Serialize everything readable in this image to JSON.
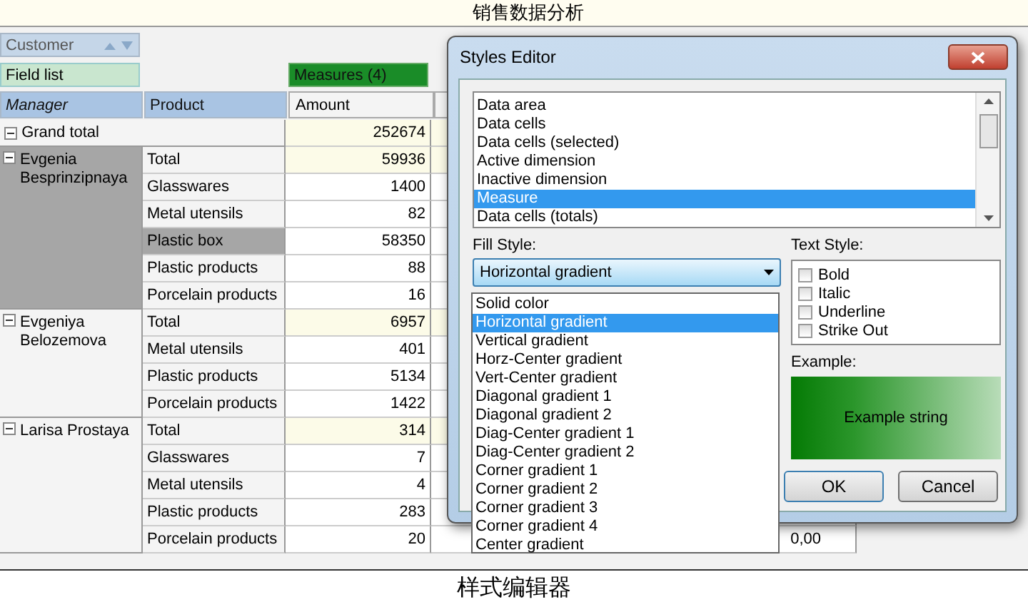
{
  "top_caption": "销售数据分析",
  "pivot": {
    "customer_field": "Customer",
    "field_list": "Field list",
    "measures": "Measures (4)",
    "row_fields": [
      {
        "label": "Manager",
        "active": true
      },
      {
        "label": "Product",
        "active": false
      }
    ],
    "columns": [
      "Amount"
    ],
    "grand_total": {
      "label": "Grand total",
      "expanded": true,
      "amount": "252674"
    },
    "groups": [
      {
        "manager": "Evgenia Besprinzipnaya",
        "expanded": true,
        "selected": true,
        "rows": [
          {
            "product": "Total",
            "kind": "total",
            "selected": false,
            "amount": "59936"
          },
          {
            "product": "Glasswares",
            "kind": "item",
            "selected": false,
            "amount": "1400"
          },
          {
            "product": "Metal utensils",
            "kind": "item",
            "selected": false,
            "amount": "82"
          },
          {
            "product": "Plastic box",
            "kind": "item",
            "selected": true,
            "amount": "58350"
          },
          {
            "product": "Plastic products",
            "kind": "item",
            "selected": false,
            "amount": "88"
          },
          {
            "product": "Porcelain products",
            "kind": "item",
            "selected": false,
            "amount": "16"
          }
        ]
      },
      {
        "manager": "Evgeniya Belozemova",
        "expanded": true,
        "selected": false,
        "rows": [
          {
            "product": "Total",
            "kind": "total",
            "selected": false,
            "amount": "6957"
          },
          {
            "product": "Metal utensils",
            "kind": "item",
            "selected": false,
            "amount": "401"
          },
          {
            "product": "Plastic products",
            "kind": "item",
            "selected": false,
            "amount": "5134"
          },
          {
            "product": "Porcelain products",
            "kind": "item",
            "selected": false,
            "amount": "1422"
          }
        ]
      },
      {
        "manager": "Larisa Prostaya",
        "expanded": true,
        "selected": false,
        "rows": [
          {
            "product": "Total",
            "kind": "total",
            "selected": false,
            "amount": "314"
          },
          {
            "product": "Glasswares",
            "kind": "item",
            "selected": false,
            "amount": "7"
          },
          {
            "product": "Metal utensils",
            "kind": "item",
            "selected": false,
            "amount": "4"
          },
          {
            "product": "Plastic products",
            "kind": "item",
            "selected": false,
            "amount": "283"
          },
          {
            "product": "Porcelain products",
            "kind": "item",
            "selected": false,
            "amount": "20",
            "column_2": "0,00"
          }
        ]
      }
    ]
  },
  "dialog": {
    "title": "Styles Editor",
    "style_items": [
      {
        "label": "Data area",
        "selected": false
      },
      {
        "label": "Data cells",
        "selected": false
      },
      {
        "label": "Data cells (selected)",
        "selected": false
      },
      {
        "label": "Active dimension",
        "selected": false
      },
      {
        "label": "Inactive dimension",
        "selected": false
      },
      {
        "label": "Measure",
        "selected": true
      },
      {
        "label": "Data cells (totals)",
        "selected": false
      }
    ],
    "fill_style_label": "Fill Style:",
    "fill_style": "Horizontal gradient",
    "fill_options": [
      {
        "label": "Solid color",
        "selected": false
      },
      {
        "label": "Horizontal gradient",
        "selected": true
      },
      {
        "label": "Vertical gradient",
        "selected": false
      },
      {
        "label": "Horz-Center gradient",
        "selected": false
      },
      {
        "label": "Vert-Center gradient",
        "selected": false
      },
      {
        "label": "Diagonal gradient 1",
        "selected": false
      },
      {
        "label": "Diagonal gradient 2",
        "selected": false
      },
      {
        "label": "Diag-Center gradient 1",
        "selected": false
      },
      {
        "label": "Diag-Center gradient 2",
        "selected": false
      },
      {
        "label": "Corner gradient 1",
        "selected": false
      },
      {
        "label": "Corner gradient 2",
        "selected": false
      },
      {
        "label": "Corner gradient 3",
        "selected": false
      },
      {
        "label": "Corner gradient 4",
        "selected": false
      },
      {
        "label": "Center gradient",
        "selected": false
      }
    ],
    "text_style_label": "Text Style:",
    "text_styles": [
      {
        "label": "Bold",
        "checked": false
      },
      {
        "label": "Italic",
        "checked": false
      },
      {
        "label": "Underline",
        "checked": false
      },
      {
        "label": "Strike Out",
        "checked": false
      }
    ],
    "example_label": "Example:",
    "example_text": "Example string",
    "buttons": [
      "OK",
      "Cancel"
    ]
  },
  "bottom_caption": "样式编辑器"
}
